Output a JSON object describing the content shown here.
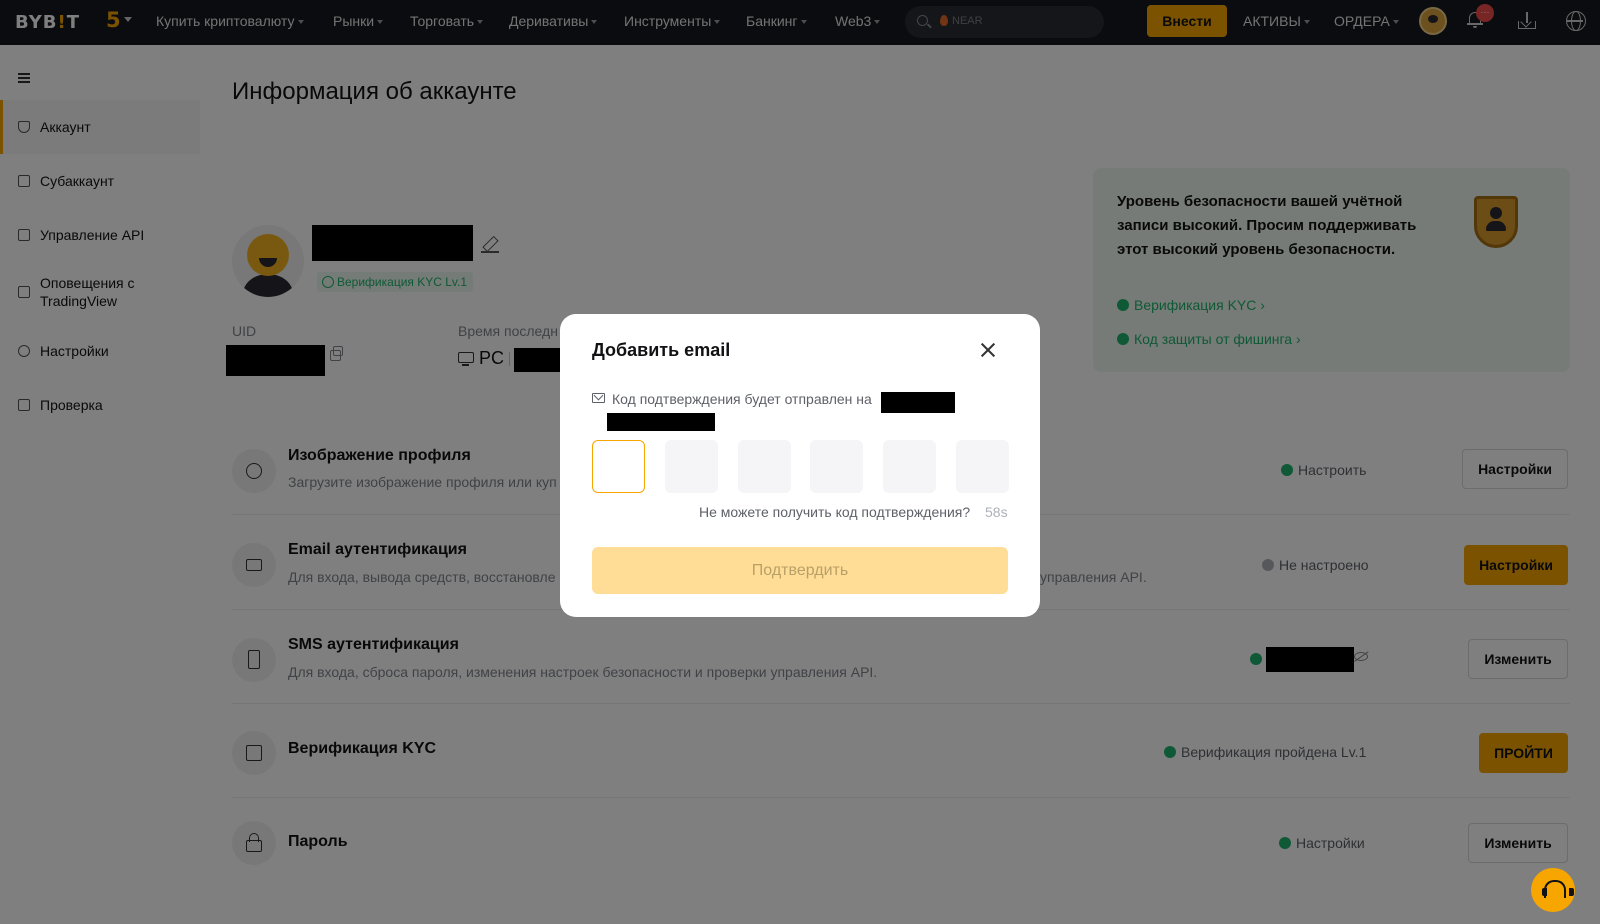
{
  "header": {
    "logo": "BYBIT",
    "anniversary": "5",
    "nav": [
      {
        "label": "Купить криптовалюту"
      },
      {
        "label": "Рынки"
      },
      {
        "label": "Торговать"
      },
      {
        "label": "Деривативы"
      },
      {
        "label": "Инструменты"
      },
      {
        "label": "Банкинг"
      },
      {
        "label": "Web3"
      }
    ],
    "search_placeholder": "NEAR",
    "deposit_label": "Внести",
    "assets_label": "АКТИВЫ",
    "orders_label": "ОРДЕРА",
    "notification_badge": "···",
    "icons": [
      "search-icon",
      "flame-icon",
      "avatar",
      "bell-icon",
      "download-icon",
      "globe-icon"
    ]
  },
  "sidebar": {
    "items": [
      {
        "label": "Аккаунт",
        "icon": "shield-icon",
        "active": true
      },
      {
        "label": "Субаккаунт",
        "icon": "subaccount-icon"
      },
      {
        "label": "Управление API",
        "icon": "api-icon"
      },
      {
        "label": "Оповещения с TradingView",
        "icon": "tradingview-icon"
      },
      {
        "label": "Настройки",
        "icon": "settings-icon"
      },
      {
        "label": "Проверка",
        "icon": "clipboard-icon"
      }
    ]
  },
  "main": {
    "title": "Информация об аккаунте",
    "kyc_badge": "Верификация KYC Lv.1",
    "uid_label": "UID",
    "last_login_label": "Время последн",
    "device": "PC",
    "security_card": {
      "text": "Уровень безопасности вашей учётной записи высокий. Просим поддерживать этот высокий уровень безопасности.",
      "links": [
        "Верификация KYC",
        "Код защиты от фишинга"
      ]
    },
    "rows": [
      {
        "title": "Изображение профиля",
        "desc": "Загрузите изображение профиля или куп",
        "status": "Настроить",
        "button": "Настройки",
        "icon": "user-circle-icon"
      },
      {
        "title": "Email аутентификация",
        "desc": "Для входа, вывода средств, восстановле",
        "desc_tail": "управления API.",
        "status": "Не настроено",
        "button": "Настройки",
        "icon": "mail-icon"
      },
      {
        "title": "SMS аутентификация",
        "desc": "Для входа, сброса пароля, изменения настроек безопасности и проверки управления API.",
        "status": "",
        "button": "Изменить",
        "icon": "phone-icon"
      },
      {
        "title": "Верификация KYC",
        "desc": "",
        "status": "Верификация пройдена Lv.1",
        "button": "ПРОЙТИ",
        "icon": "id-badge-icon"
      },
      {
        "title": "Пароль",
        "desc": "",
        "status": "Настройки",
        "button": "Изменить",
        "icon": "lock-icon"
      }
    ]
  },
  "modal": {
    "title": "Добавить email",
    "hint": "Код подтверждения будет отправлен на",
    "code_length": 6,
    "resend_text": "Не можете получить код подтверждения?",
    "timer": "58s",
    "confirm_label": "Подтвердить"
  },
  "colors": {
    "accent": "#f7a600",
    "success": "#20b26c",
    "header_bg": "#17181e"
  }
}
